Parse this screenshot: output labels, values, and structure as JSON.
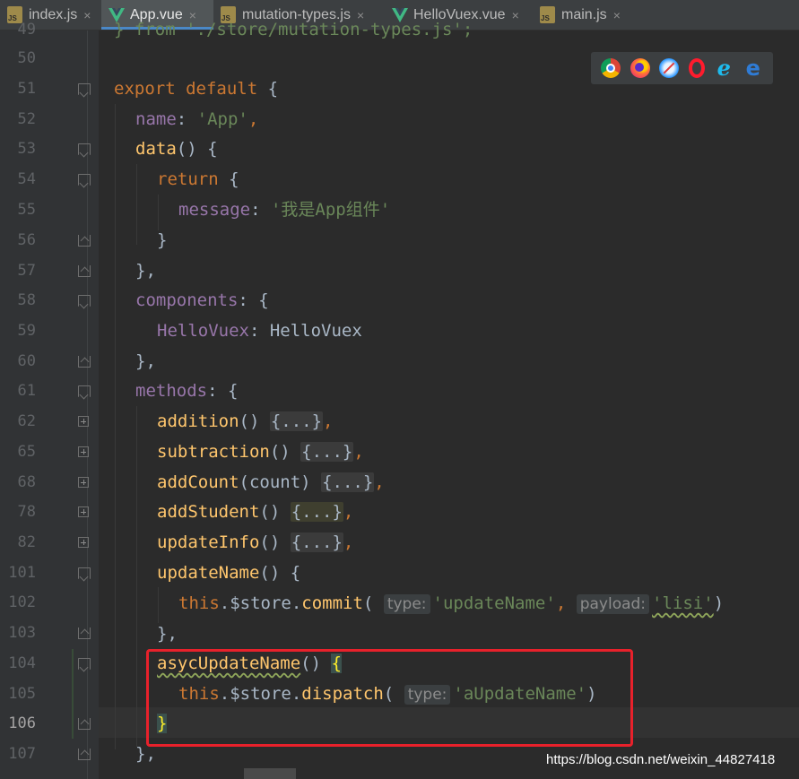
{
  "tabs": [
    {
      "label": "index.js",
      "icon": "js-file-icon",
      "active": false
    },
    {
      "label": "App.vue",
      "icon": "vue-file-icon",
      "active": true
    },
    {
      "label": "mutation-types.js",
      "icon": "js-file-icon",
      "active": false
    },
    {
      "label": "HelloVuex.vue",
      "icon": "vue-file-icon",
      "active": false
    },
    {
      "label": "main.js",
      "icon": "js-file-icon",
      "active": false
    }
  ],
  "close_glyph": "×",
  "js_badge": "JS",
  "gutter": {
    "line_numbers": [
      "49",
      "50",
      "51",
      "52",
      "53",
      "54",
      "55",
      "56",
      "57",
      "58",
      "59",
      "60",
      "61",
      "62",
      "65",
      "68",
      "78",
      "82",
      "101",
      "102",
      "103",
      "104",
      "105",
      "106",
      "107"
    ],
    "current_line": "106"
  },
  "code": {
    "l49": "} from './store/mutation-types.js';",
    "l51_kw": "export default",
    "l51_rest": " {",
    "l52_prop": "name",
    "l52_str": "'App'",
    "l53_fn": "data",
    "l53_rest": "() {",
    "l54_kw": "return",
    "l54_rest": " {",
    "l55_prop": "message",
    "l55_str": "'我是App组件'",
    "l56": "}",
    "l57": "},",
    "l58_prop": "components",
    "l58_rest": ": {",
    "l59_prop": "HelloVuex",
    "l59_rest": ": HelloVuex",
    "l60": "},",
    "l61_prop": "methods",
    "l61_rest": ": {",
    "l62_fn": "addition",
    "l65_fn": "subtraction",
    "l68_fn": "addCount",
    "l68_arg": "count",
    "l78_fn": "addStudent",
    "l82_fn": "updateInfo",
    "l101_fn": "updateName",
    "l102_this": "this",
    "l102_mid": ".$store.",
    "l102_call": "commit",
    "l102_hint1": "type:",
    "l102_str1": "'updateName'",
    "l102_hint2": "payload:",
    "l102_str2": "'lisi'",
    "l103": "},",
    "l104_fn": "asycUpdateName",
    "l105_this": "this",
    "l105_mid": ".$store.",
    "l105_call": "dispatch",
    "l105_hint": "type:",
    "l105_str": "'aUpdateName'",
    "l106": "}",
    "l107": "},",
    "folded": "{...}"
  },
  "browsers": [
    "chrome-icon",
    "firefox-icon",
    "safari-icon",
    "opera-icon",
    "ie-icon",
    "edge-icon"
  ],
  "watermark": "https://blog.csdn.net/weixin_44827418"
}
